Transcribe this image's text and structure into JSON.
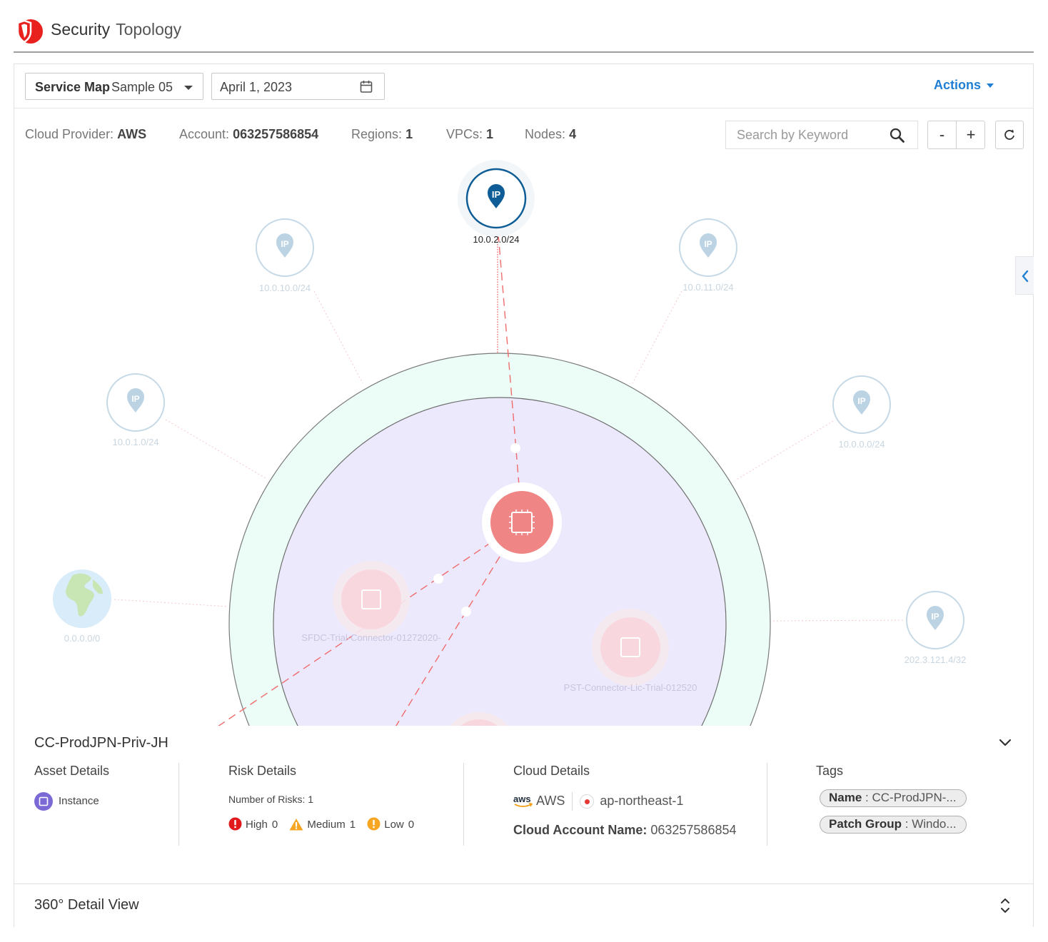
{
  "header": {
    "title_primary": "Security",
    "title_secondary": "Topology",
    "logo_icon": "shield-logo-icon",
    "brand_color": "#e8201e"
  },
  "toolbar": {
    "service_map_label": "Service Map",
    "service_map_value": "Sample 05",
    "date_value": "April 1, 2023",
    "actions_label": "Actions"
  },
  "stats": {
    "cloud_provider_label": "Cloud Provider:",
    "cloud_provider_value": "AWS",
    "account_label": "Account:",
    "account_value": "063257586854",
    "regions_label": "Regions:",
    "regions_value": "1",
    "vpcs_label": "VPCs:",
    "vpcs_value": "1",
    "nodes_label": "Nodes:",
    "nodes_value": "4"
  },
  "search": {
    "placeholder": "Search by Keyword"
  },
  "zoom": {
    "minus_label": "-",
    "plus_label": "+"
  },
  "graph": {
    "ip_nodes": [
      {
        "label": "10.0.2.0/24",
        "active": true
      },
      {
        "label": "10.0.10.0/24",
        "active": false
      },
      {
        "label": "10.0.11.0/24",
        "active": false
      },
      {
        "label": "10.0.1.0/24",
        "active": false
      },
      {
        "label": "10.0.0.0/24",
        "active": false
      },
      {
        "label": "202.3.121.4/32",
        "active": false
      }
    ],
    "internet_node": {
      "label": "0.0.0.0/0"
    },
    "instances": [
      {
        "label": "",
        "active": true
      },
      {
        "label": "SFDC-Trial-Connector-01272020-",
        "active": false
      },
      {
        "label": "PST-Connector-Lic-Trial-012520",
        "active": false
      }
    ],
    "ip_marker_text": "IP",
    "colors": {
      "active_ip": "#0e5d96",
      "inactive_ip": "#bcd3e4",
      "instance": "#ef8585",
      "outer_ring": "#ebfdf6",
      "inner_zone": "#ece9fd",
      "edge": "#f06b6b"
    }
  },
  "detail": {
    "title": "CC-ProdJPN-Priv-JH",
    "asset_details": {
      "heading": "Asset Details",
      "type": "Instance"
    },
    "risk_details": {
      "heading": "Risk Details",
      "count_label": "Number of Risks: 1",
      "high_label": "High",
      "high_value": "0",
      "medium_label": "Medium",
      "medium_value": "1",
      "low_label": "Low",
      "low_value": "0"
    },
    "cloud_details": {
      "heading": "Cloud Details",
      "provider": "AWS",
      "aws_logo_text": "aws",
      "region": "ap-northeast-1",
      "account_name_label": "Cloud Account Name:",
      "account_name_value": "063257586854"
    },
    "tags": {
      "heading": "Tags",
      "items": [
        {
          "key": "Name",
          "value": "CC-ProdJPN-..."
        },
        {
          "key": "Patch Group",
          "value": "Windo..."
        }
      ]
    }
  },
  "view360": {
    "title": "360° Detail View"
  }
}
